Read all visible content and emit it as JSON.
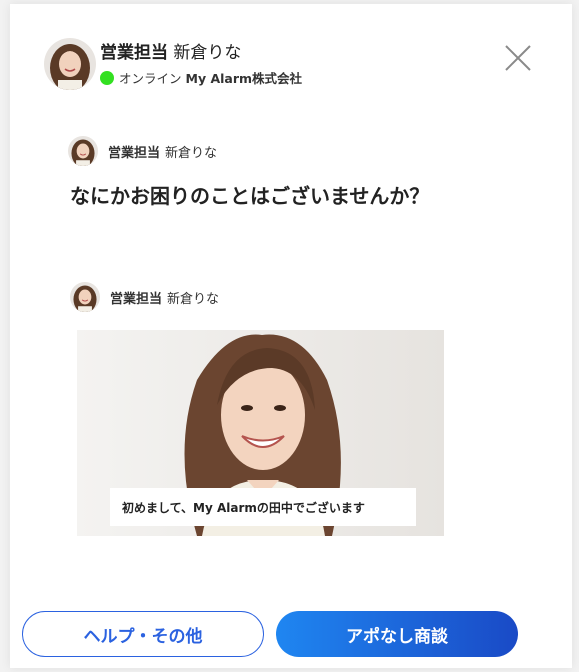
{
  "header": {
    "role": "営業担当",
    "name": "新倉りな",
    "status": "オンライン",
    "company": "My Alarm株式会社"
  },
  "messages": [
    {
      "role": "営業担当",
      "name": "新倉りな",
      "text": "なにかお困りのことはございませんか？"
    },
    {
      "role": "営業担当",
      "name": "新倉りな",
      "caption": "初めまして、My Alarmの田中でございます"
    }
  ],
  "buttons": {
    "help": "ヘルプ・その他",
    "meeting": "アポなし商談"
  },
  "colors": {
    "online": "#33e021",
    "accent": "#2b62e0",
    "button_gradient_start": "#1f86f1",
    "button_gradient_end": "#1a4ac6"
  }
}
